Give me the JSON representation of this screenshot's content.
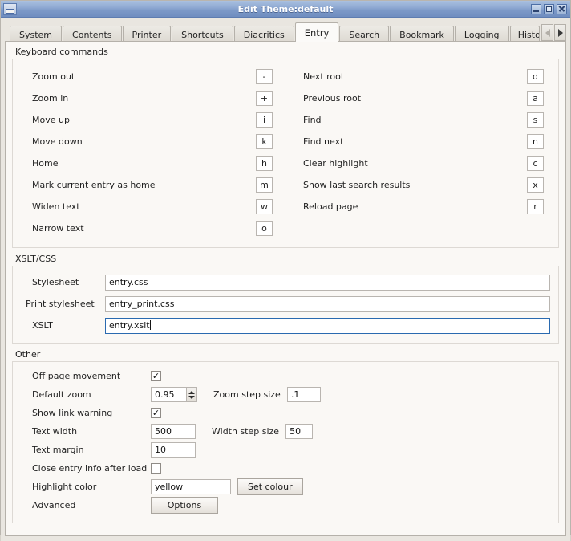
{
  "window": {
    "title": "Edit Theme:default",
    "system_menu_icon": "window-icon",
    "buttons": [
      {
        "name": "minimize-button",
        "icon": "minimize-icon"
      },
      {
        "name": "maximize-button",
        "icon": "maximize-icon"
      },
      {
        "name": "close-button",
        "icon": "close-icon"
      }
    ]
  },
  "tabs": {
    "items": [
      {
        "label": "System",
        "selected": false
      },
      {
        "label": "Contents",
        "selected": false
      },
      {
        "label": "Printer",
        "selected": false
      },
      {
        "label": "Shortcuts",
        "selected": false
      },
      {
        "label": "Diacritics",
        "selected": false
      },
      {
        "label": "Entry",
        "selected": true
      },
      {
        "label": "Search",
        "selected": false
      },
      {
        "label": "Bookmark",
        "selected": false
      },
      {
        "label": "Logging",
        "selected": false
      },
      {
        "label": "Histo",
        "selected": false
      }
    ],
    "scroll_left_icon": "triangle-left-icon",
    "scroll_right_icon": "triangle-right-icon"
  },
  "keyboard_commands": {
    "title": "Keyboard commands",
    "left": [
      {
        "label": "Zoom out",
        "key": "-"
      },
      {
        "label": "Zoom in",
        "key": "+"
      },
      {
        "label": "Move up",
        "key": "i"
      },
      {
        "label": "Move down",
        "key": "k"
      },
      {
        "label": "Home",
        "key": "h"
      },
      {
        "label": "Mark current entry as home",
        "key": "m"
      },
      {
        "label": "Widen text",
        "key": "w"
      },
      {
        "label": "Narrow text",
        "key": "o"
      }
    ],
    "right": [
      {
        "label": "Next root",
        "key": "d"
      },
      {
        "label": "Previous root",
        "key": "a"
      },
      {
        "label": "Find",
        "key": "s"
      },
      {
        "label": "Find next",
        "key": "n"
      },
      {
        "label": "Clear highlight",
        "key": "c"
      },
      {
        "label": "Show last search results",
        "key": "x"
      },
      {
        "label": "Reload page",
        "key": "r"
      }
    ]
  },
  "xslt_css": {
    "title": "XSLT/CSS",
    "stylesheet_label": "Stylesheet",
    "stylesheet_value": "entry.css",
    "print_stylesheet_label": "Print stylesheet",
    "print_stylesheet_value": "entry_print.css",
    "xslt_label": "XSLT",
    "xslt_value": "entry.xslt"
  },
  "other": {
    "title": "Other",
    "off_page_movement_label": "Off page movement",
    "off_page_movement_checked": "✓",
    "default_zoom_label": "Default zoom",
    "default_zoom_value": "0.95",
    "zoom_step_size_label": "Zoom step size",
    "zoom_step_size_value": ".1",
    "show_link_warning_label": "Show link warning",
    "show_link_warning_checked": "✓",
    "text_width_label": "Text width",
    "text_width_value": "500",
    "width_step_size_label": "Width step size",
    "width_step_size_value": "50",
    "text_margin_label": "Text margin",
    "text_margin_value": "10",
    "close_entry_info_label": "Close entry info after load",
    "close_entry_info_checked": "",
    "highlight_color_label": "Highlight color",
    "highlight_color_value": "yellow",
    "set_colour_label": "Set colour",
    "advanced_label": "Advanced",
    "options_label": "Options"
  },
  "colors": {
    "titlebar_start": "#a9c0e0",
    "titlebar_end": "#6f8dc0",
    "window_bg": "#e9e6e0",
    "page_bg": "#faf8f5",
    "focus_border": "#2a6ab0"
  }
}
